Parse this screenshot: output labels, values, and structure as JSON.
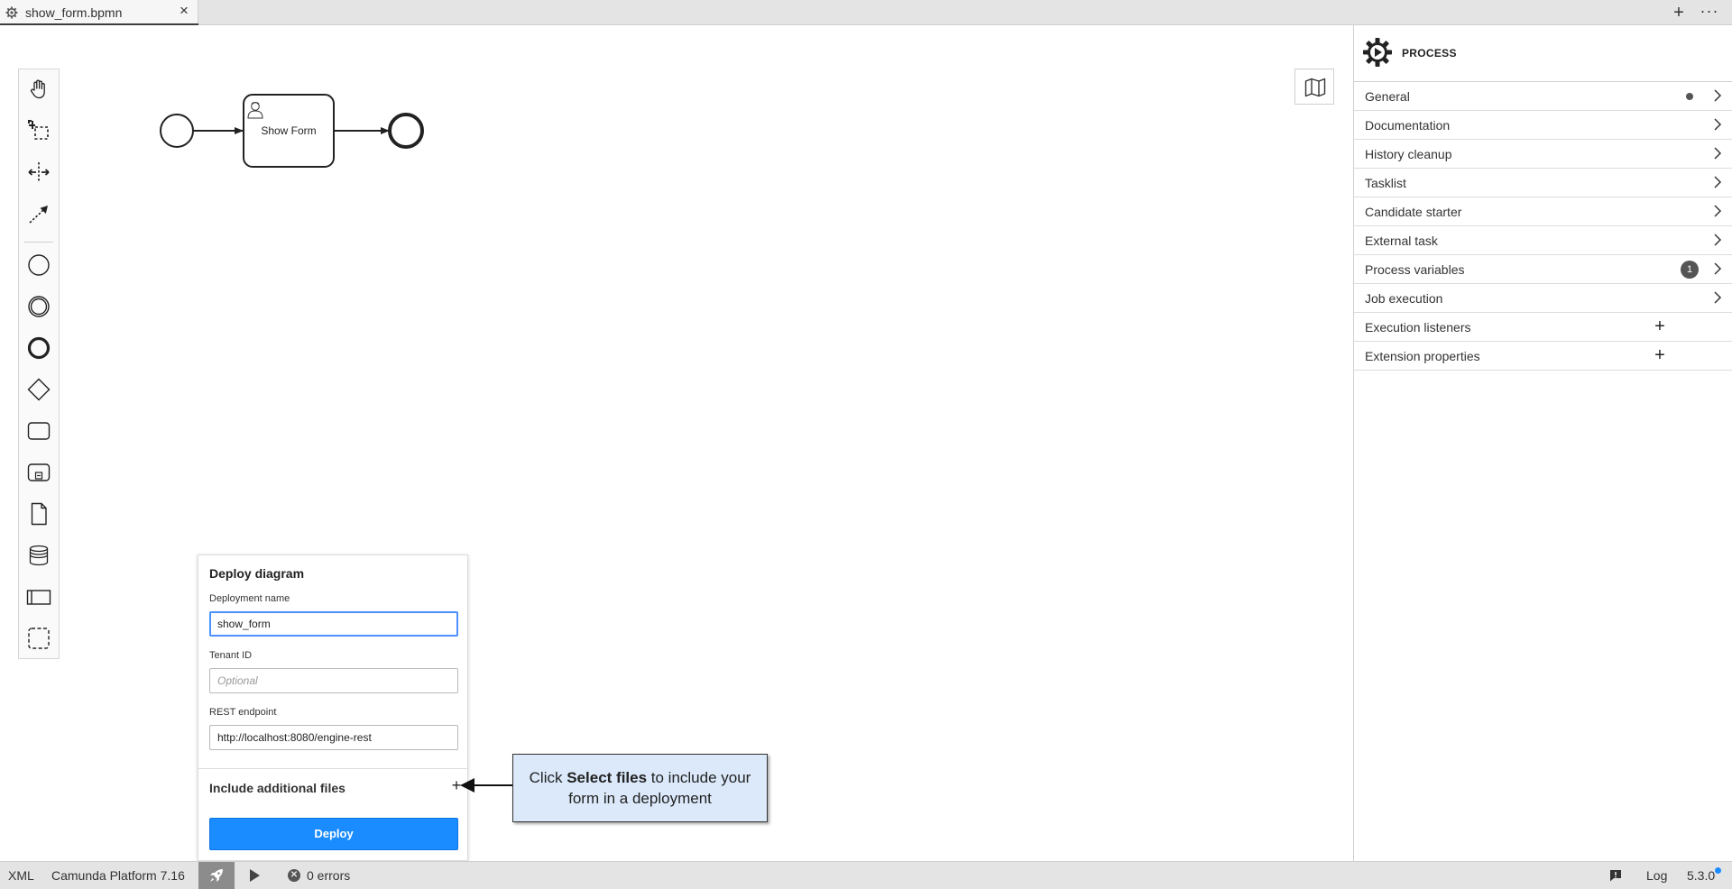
{
  "tab": {
    "filename": "show_form.bpmn",
    "close": "×"
  },
  "tabbar_actions": {
    "new": "+",
    "more": "···"
  },
  "diagram": {
    "task_label": "Show Form"
  },
  "deploy": {
    "title": "Deploy diagram",
    "deployment_name_label": "Deployment name",
    "deployment_name_value": "show_form",
    "tenant_label": "Tenant ID",
    "tenant_placeholder": "Optional",
    "endpoint_label": "REST endpoint",
    "endpoint_value": "http://localhost:8080/engine-rest",
    "include_files_label": "Include additional files",
    "include_plus": "+",
    "deploy_button": "Deploy"
  },
  "callout": {
    "pre": "Click ",
    "bold": "Select files",
    "post": " to include your form in a deployment"
  },
  "properties": {
    "title": "PROCESS",
    "groups": [
      {
        "label": "General",
        "indicator": "dot"
      },
      {
        "label": "Documentation"
      },
      {
        "label": "History cleanup"
      },
      {
        "label": "Tasklist"
      },
      {
        "label": "Candidate starter"
      },
      {
        "label": "External task"
      },
      {
        "label": "Process variables",
        "badge": "1"
      },
      {
        "label": "Job execution"
      },
      {
        "label": "Execution listeners",
        "plus": "+"
      },
      {
        "label": "Extension properties",
        "plus": "+"
      }
    ]
  },
  "statusbar": {
    "xml": "XML",
    "platform": "Camunda Platform 7.16",
    "errors": "0 errors",
    "log": "Log",
    "version": "5.3.0"
  },
  "colors": {
    "accent": "#1a8cff",
    "callout_bg": "#dbe9fa",
    "focus_border": "#4d90fe"
  }
}
